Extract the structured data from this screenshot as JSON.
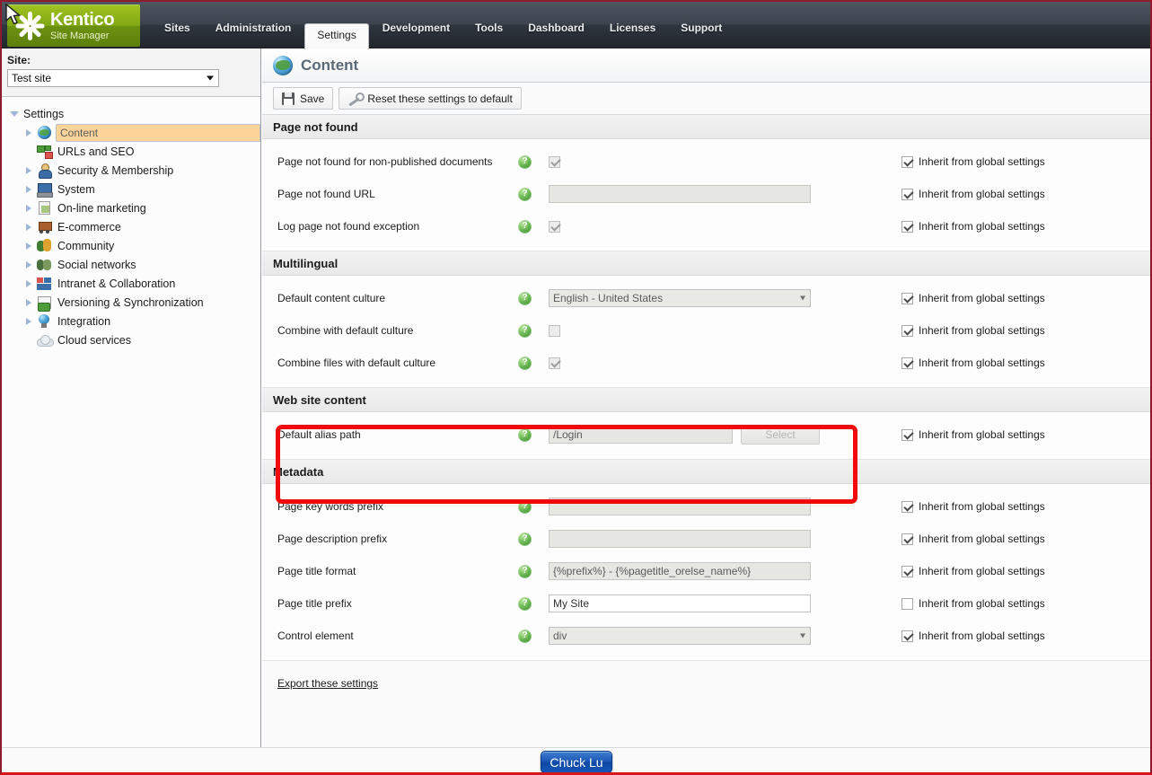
{
  "brand": {
    "name": "Kentico",
    "subtitle": "Site Manager"
  },
  "nav": {
    "items": [
      {
        "label": "Sites",
        "active": false
      },
      {
        "label": "Administration",
        "active": false
      },
      {
        "label": "Settings",
        "active": true
      },
      {
        "label": "Development",
        "active": false
      },
      {
        "label": "Tools",
        "active": false
      },
      {
        "label": "Dashboard",
        "active": false
      },
      {
        "label": "Licenses",
        "active": false
      },
      {
        "label": "Support",
        "active": false
      }
    ]
  },
  "sidebar": {
    "site_label": "Site:",
    "site_value": "Test site",
    "root": "Settings",
    "items": [
      {
        "label": "Content",
        "icon": "globe-icon",
        "expandable": true,
        "selected": true
      },
      {
        "label": "URLs and SEO",
        "icon": "sitemap-icon",
        "expandable": false,
        "selected": false
      },
      {
        "label": "Security & Membership",
        "icon": "user-icon",
        "expandable": true,
        "selected": false
      },
      {
        "label": "System",
        "icon": "computer-icon",
        "expandable": true,
        "selected": false
      },
      {
        "label": "On-line marketing",
        "icon": "document-icon",
        "expandable": true,
        "selected": false
      },
      {
        "label": "E-commerce",
        "icon": "cart-icon",
        "expandable": true,
        "selected": false
      },
      {
        "label": "Community",
        "icon": "people-icon",
        "expandable": true,
        "selected": false
      },
      {
        "label": "Social networks",
        "icon": "group-icon",
        "expandable": true,
        "selected": false
      },
      {
        "label": "Intranet & Collaboration",
        "icon": "blocks-icon",
        "expandable": true,
        "selected": false
      },
      {
        "label": "Versioning & Synchronization",
        "icon": "versions-icon",
        "expandable": true,
        "selected": false
      },
      {
        "label": "Integration",
        "icon": "integration-icon",
        "expandable": true,
        "selected": false
      },
      {
        "label": "Cloud services",
        "icon": "cloud-icon",
        "expandable": false,
        "selected": false
      }
    ]
  },
  "page": {
    "title": "Content",
    "icon": "globe-icon"
  },
  "toolbar": {
    "save_label": "Save",
    "reset_label": "Reset these settings to default"
  },
  "inherit_label": "Inherit from global settings",
  "sections": [
    {
      "title": "Page not found",
      "rows": [
        {
          "label": "Page not found for non-published documents",
          "type": "checkbox",
          "checked": true,
          "disabled": true,
          "value": "",
          "inherit": true
        },
        {
          "label": "Page not found URL",
          "type": "text",
          "value": "",
          "disabled": true,
          "inherit": true
        },
        {
          "label": "Log page not found exception",
          "type": "checkbox",
          "checked": true,
          "disabled": true,
          "value": "",
          "inherit": true
        }
      ]
    },
    {
      "title": "Multilingual",
      "rows": [
        {
          "label": "Default content culture",
          "type": "select",
          "value": "English - United States",
          "disabled": true,
          "inherit": true
        },
        {
          "label": "Combine with default culture",
          "type": "checkbox",
          "checked": false,
          "disabled": true,
          "value": "",
          "inherit": true
        },
        {
          "label": "Combine files with default culture",
          "type": "checkbox",
          "checked": true,
          "disabled": true,
          "value": "",
          "inherit": true
        }
      ]
    },
    {
      "title": "Web site content",
      "highlighted": true,
      "rows": [
        {
          "label": "Default alias path",
          "type": "text-with-button",
          "value": "/Login",
          "disabled": true,
          "button_label": "Select",
          "inherit": true
        }
      ]
    },
    {
      "title": "Metadata",
      "rows": [
        {
          "label": "Page key words prefix",
          "type": "text",
          "value": "",
          "disabled": true,
          "inherit": true
        },
        {
          "label": "Page description prefix",
          "type": "text",
          "value": "",
          "disabled": true,
          "inherit": true
        },
        {
          "label": "Page title format",
          "type": "text",
          "value": "{%prefix%} - {%pagetitle_orelse_name%}",
          "disabled": true,
          "inherit": true
        },
        {
          "label": "Page title prefix",
          "type": "text",
          "value": "My Site",
          "disabled": false,
          "inherit": false
        },
        {
          "label": "Control element",
          "type": "select",
          "value": "div",
          "disabled": true,
          "inherit": true
        }
      ]
    }
  ],
  "export_link": "Export these settings",
  "bottom_badge": "Chuck Lu",
  "help_glyph": "?",
  "colors": {
    "highlight_rect": "#f00a0a",
    "brand_green": "#82a814",
    "selected_tree": "#fcd49a",
    "badge_blue": "#1b57b4",
    "window_border": "#8e1b2a"
  }
}
